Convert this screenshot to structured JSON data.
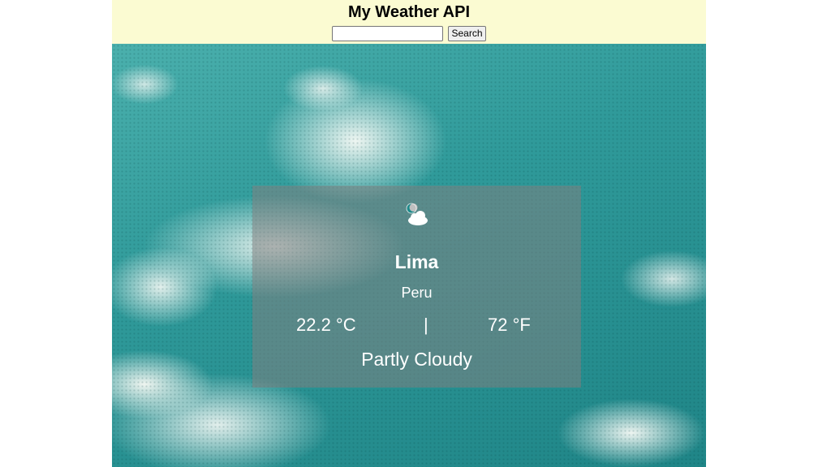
{
  "header": {
    "title": "My Weather API",
    "search_value": "",
    "search_placeholder": "",
    "search_button_label": "Search"
  },
  "weather": {
    "icon": "partly-cloudy-night-icon",
    "city": "Lima",
    "country": "Peru",
    "temp_c": "22.2 °C",
    "separator": "|",
    "temp_f": "72 °F",
    "condition": "Partly Cloudy"
  },
  "colors": {
    "header_bg": "#fbfbd2",
    "card_bg": "rgba(128,128,128,0.55)",
    "sky": "#2f9a9a"
  }
}
